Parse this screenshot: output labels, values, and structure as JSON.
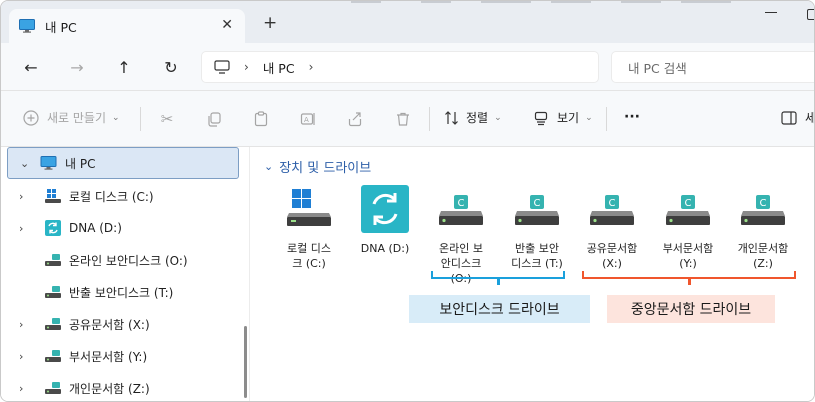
{
  "tab": {
    "title": "내 PC",
    "close": "✕",
    "add": "+"
  },
  "nav": {
    "back": "←",
    "forward": "→",
    "up": "↑",
    "refresh": "↻"
  },
  "address": {
    "separator": "›",
    "location": "내 PC"
  },
  "search": {
    "placeholder": "내 PC 검색"
  },
  "toolbar": {
    "new_label": "새로 만들기",
    "sort_label": "정렬",
    "view_label": "보기",
    "more_label": "···",
    "details_label": "세"
  },
  "sidebar": {
    "items": [
      {
        "label": "내 PC"
      },
      {
        "label": "로컬 디스크 (C:)"
      },
      {
        "label": "DNA (D:)"
      },
      {
        "label": "온라인 보안디스크 (O:)"
      },
      {
        "label": "반출 보안디스크 (T:)"
      },
      {
        "label": "공유문서함 (X:)"
      },
      {
        "label": "부서문서함 (Y:)"
      },
      {
        "label": "개인문서함 (Z:)"
      }
    ]
  },
  "content": {
    "section_title": "장치 및 드라이브",
    "drives": [
      {
        "line1": "로컬 디스",
        "line2": "크 (C:)",
        "line3": ""
      },
      {
        "line1": "DNA (D:)",
        "line2": "",
        "line3": ""
      },
      {
        "line1": "온라인 보",
        "line2": "안디스크",
        "line3": "(O:)"
      },
      {
        "line1": "반출 보안",
        "line2": "디스크 (T:)",
        "line3": ""
      },
      {
        "line1": "공유문서함",
        "line2": "(X:)",
        "line3": ""
      },
      {
        "line1": "부서문서함",
        "line2": "(Y:)",
        "line3": ""
      },
      {
        "line1": "개인문서함",
        "line2": "(Z:)",
        "line3": ""
      }
    ]
  },
  "callouts": {
    "secure": "보안디스크 드라이브",
    "central": "중앙문서함 드라이브"
  },
  "colors": {
    "accent_blue": "#2c5ea8",
    "secure_bracket": "#1aa0dc",
    "secure_box": "#d8ecf8",
    "central_bracket": "#f0562d",
    "central_box": "#fde4dd",
    "drive_badge": "#35b3b0",
    "dna_tile": "#29b5c6"
  }
}
